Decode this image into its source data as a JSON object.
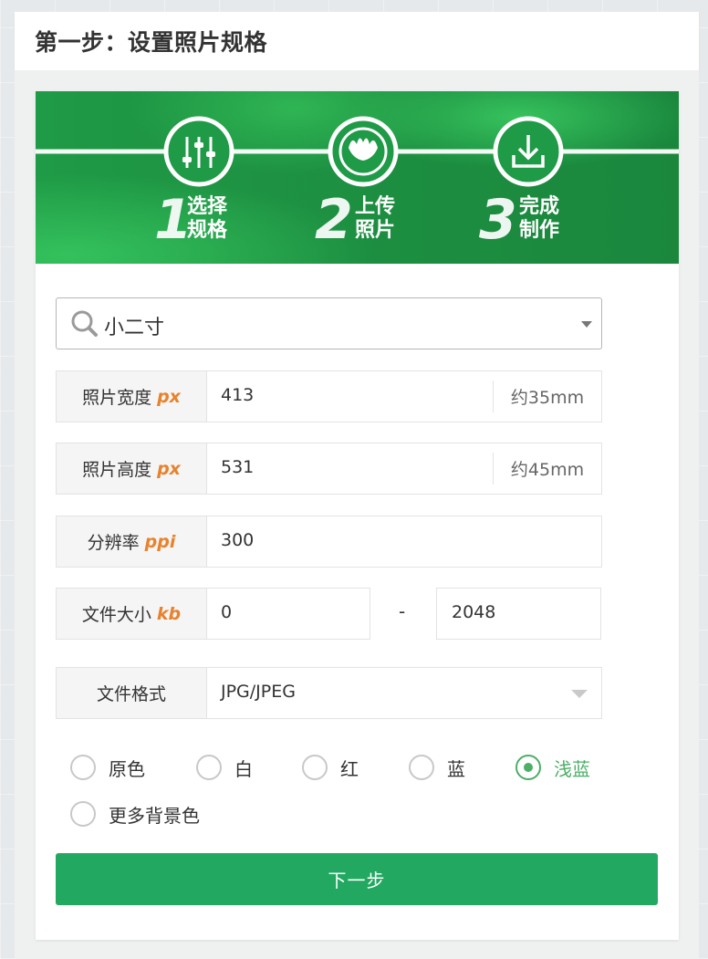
{
  "header": {
    "title": "第一步：设置照片规格"
  },
  "steps": [
    {
      "number": "1",
      "line1": "选择",
      "line2": "规格",
      "icon": "sliders-icon"
    },
    {
      "number": "2",
      "line1": "上传",
      "line2": "照片",
      "icon": "face-icon"
    },
    {
      "number": "3",
      "line1": "完成",
      "line2": "制作",
      "icon": "download-icon"
    }
  ],
  "size_select": {
    "value": "小二寸",
    "icon": "search-icon"
  },
  "width": {
    "label": "照片宽度",
    "unit": "px",
    "value": "413",
    "suffix": "约35mm"
  },
  "height": {
    "label": "照片高度",
    "unit": "px",
    "value": "531",
    "suffix": "约45mm"
  },
  "resolution": {
    "label": "分辨率",
    "unit": "ppi",
    "value": "300"
  },
  "file_size": {
    "label": "文件大小",
    "unit": "kb",
    "min": "0",
    "separator": "-",
    "max": "2048"
  },
  "file_format": {
    "label": "文件格式",
    "value": "JPG/JPEG"
  },
  "background_colors": {
    "options": [
      "原色",
      "白",
      "红",
      "蓝",
      "浅蓝",
      "更多背景色"
    ],
    "selected": "浅蓝"
  },
  "next_button": {
    "label": "下一步"
  },
  "colors": {
    "accent": "#22a860",
    "unit": "#e8822c",
    "banner": "#1f9a46",
    "selected": "#4caf68"
  }
}
